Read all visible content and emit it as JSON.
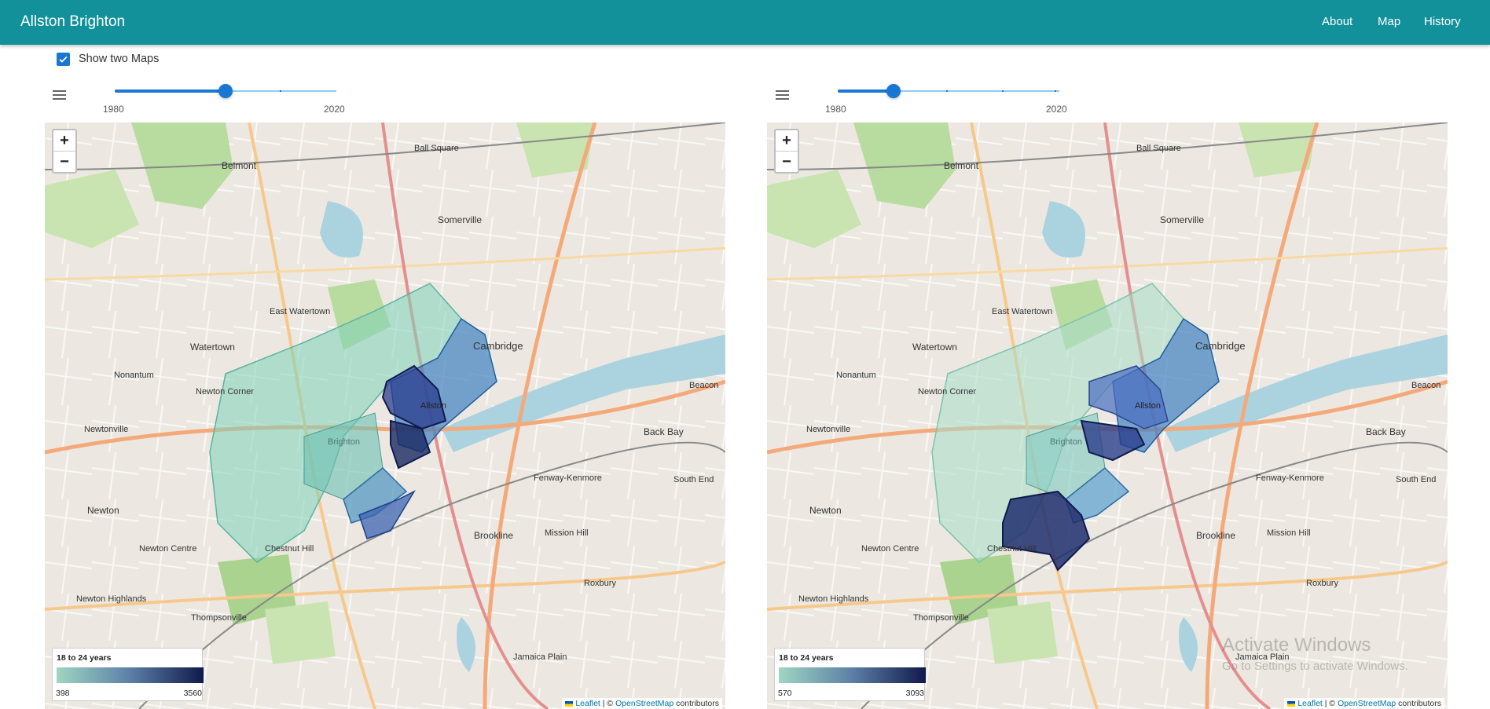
{
  "header": {
    "title": "Allston Brighton",
    "nav": [
      "About",
      "Map",
      "History"
    ],
    "background": "#12919a"
  },
  "controls": {
    "show_two_maps": {
      "label": "Show two Maps",
      "checked": true
    }
  },
  "maps": [
    {
      "slider": {
        "min_label": "1980",
        "max_label": "2020",
        "value_fraction": 0.5
      },
      "legend": {
        "title": "18 to 24 years",
        "min": "398",
        "max": "3560"
      },
      "attribution": {
        "leaflet": "Leaflet",
        "sep": " | © ",
        "osm": "OpenStreetMap",
        "contrib": " contributors"
      }
    },
    {
      "slider": {
        "min_label": "1980",
        "max_label": "2020",
        "value_fraction": 0.25
      },
      "legend": {
        "title": "18 to 24 years",
        "min": "570",
        "max": "3093"
      },
      "attribution": {
        "leaflet": "Leaflet",
        "sep": " | © ",
        "osm": "OpenStreetMap",
        "contrib": " contributors"
      }
    }
  ],
  "map_labels": [
    "Belmont",
    "Somerville",
    "Ball Square",
    "Cambridge",
    "Watertown",
    "East Watertown",
    "Nonantum",
    "Newton Corner",
    "Newtonville",
    "Newton",
    "Newton Centre",
    "Chestnut Hill",
    "Brookline",
    "Mission Hill",
    "Fenway-Kenmore",
    "Back Bay",
    "South End",
    "Roxbury",
    "Jamaica Plain",
    "Newton Highlands",
    "Thompsonville",
    "Allston",
    "Brighton",
    "Beacon"
  ],
  "watermark": {
    "line1": "Activate Windows",
    "line2": "Go to Settings to activate Windows."
  },
  "colors": {
    "accent": "#1976d2",
    "legend_low": "#9fd6c2",
    "legend_high": "#101a4c"
  }
}
